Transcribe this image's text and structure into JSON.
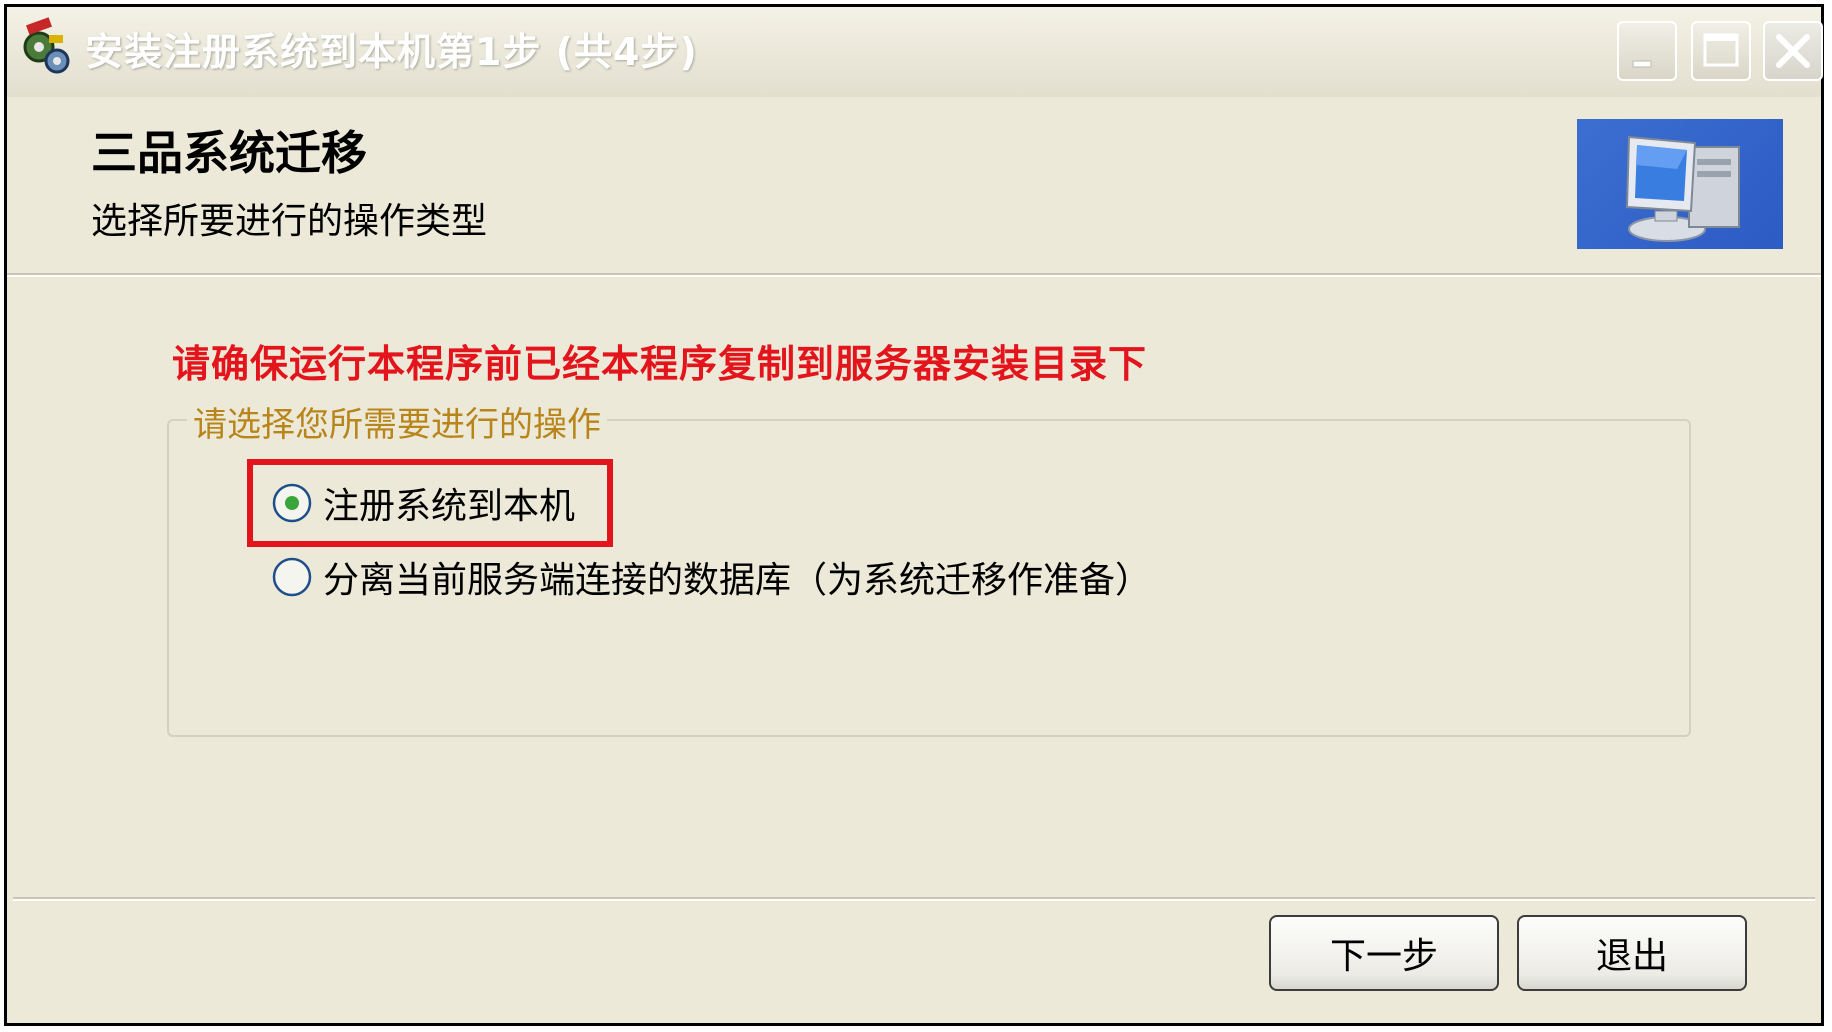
{
  "window": {
    "title": "安装注册系统到本机第1步 (共4步)"
  },
  "header": {
    "title": "三品系统迁移",
    "subtitle": "选择所要进行的操作类型"
  },
  "main": {
    "warning": "请确保运行本程序前已经本程序复制到服务器安装目录下",
    "group_label": "请选择您所需要进行的操作",
    "options": [
      {
        "label": "注册系统到本机",
        "selected": true
      },
      {
        "label": "分离当前服务端连接的数据库（为系统迁移作准备）",
        "selected": false
      }
    ]
  },
  "footer": {
    "next_label": "下一步",
    "exit_label": "退出"
  },
  "colors": {
    "warning": "#e3141b",
    "highlight": "#e3141b",
    "group_label": "#b8851b",
    "dialog_bg": "#ece9d8"
  },
  "icons": [
    "app-icon",
    "minimize-icon",
    "maximize-icon",
    "close-icon",
    "computer-icon",
    "radio-selected-icon",
    "radio-unselected-icon"
  ]
}
